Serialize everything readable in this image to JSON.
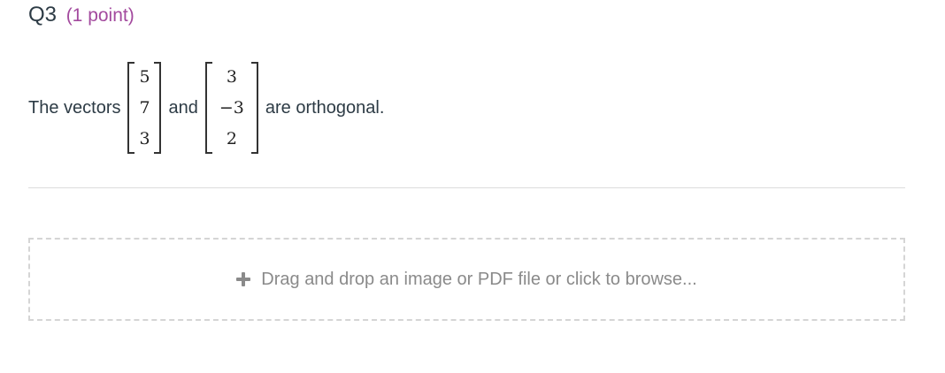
{
  "question": {
    "number": "Q3",
    "points": "(1 point)"
  },
  "prompt": {
    "prefix": "The vectors",
    "vector_a": [
      "5",
      "7",
      "3"
    ],
    "conjunction": "and",
    "vector_b": [
      "3",
      "−3",
      "2"
    ],
    "suffix": "are orthogonal."
  },
  "upload": {
    "icon": "plus-icon",
    "label": "Drag and drop an image or PDF file or click to browse..."
  },
  "colors": {
    "points_accent": "#a34a9e",
    "text": "#2d3b45",
    "dropzone_text": "#8a8a8a"
  }
}
